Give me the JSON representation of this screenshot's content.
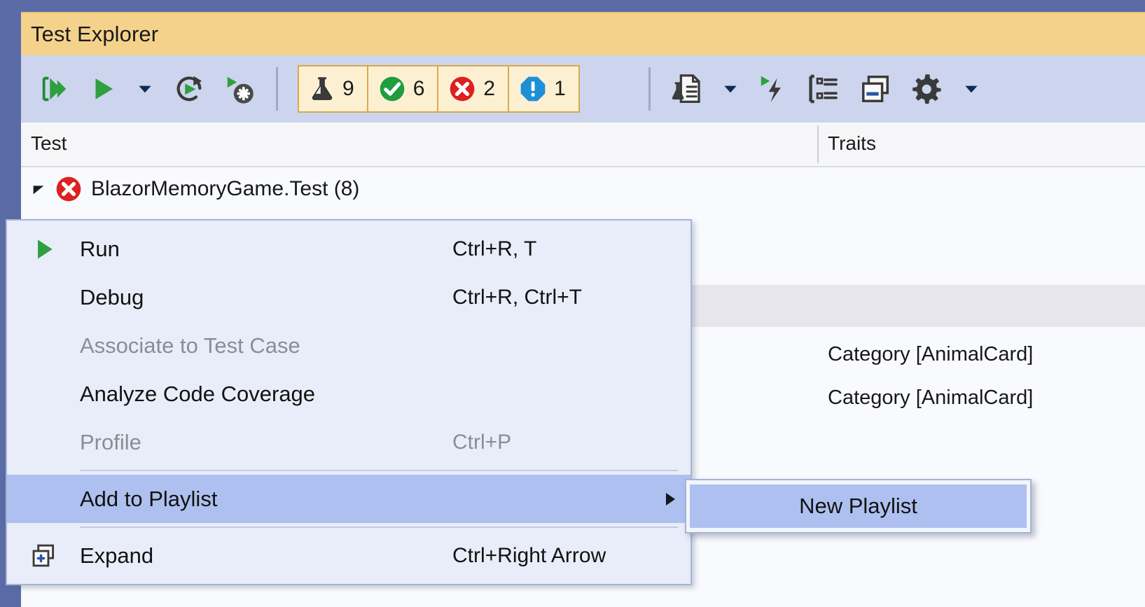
{
  "window": {
    "title": "Test Explorer",
    "chrome_color": "#5a6ba6",
    "titlebar_color": "#f5d28c",
    "toolbar_color": "#ccd5ed"
  },
  "toolbar": {
    "buttons": [
      {
        "name": "run-all-tests",
        "icon": "run-all-icon"
      },
      {
        "name": "run-selected-tests",
        "icon": "play-icon"
      },
      {
        "name": "run-dropdown",
        "icon": "chevron-down-icon"
      },
      {
        "name": "repeat-last-run",
        "icon": "repeat-run-icon"
      },
      {
        "name": "stop-test-run",
        "icon": "stop-run-icon"
      }
    ],
    "counters": [
      {
        "name": "total-tests",
        "icon": "flask-icon",
        "value": "9"
      },
      {
        "name": "passed-tests",
        "icon": "check-circle-icon",
        "value": "6"
      },
      {
        "name": "failed-tests",
        "icon": "error-circle-icon",
        "value": "2"
      },
      {
        "name": "skipped-tests",
        "icon": "info-octagon-icon",
        "value": "1"
      }
    ],
    "right_buttons": [
      {
        "name": "test-detail-summary",
        "icon": "test-document-icon"
      },
      {
        "name": "summary-dropdown",
        "icon": "chevron-down-icon"
      },
      {
        "name": "run-until-failure",
        "icon": "lightning-run-icon"
      },
      {
        "name": "group-by",
        "icon": "group-by-icon"
      },
      {
        "name": "expand-collapse",
        "icon": "window-copy-icon"
      },
      {
        "name": "settings",
        "icon": "gear-icon"
      },
      {
        "name": "settings-dropdown",
        "icon": "chevron-down-icon"
      }
    ]
  },
  "grid": {
    "columns": [
      {
        "key": "test",
        "label": "Test"
      },
      {
        "key": "traits",
        "label": "Traits"
      }
    ],
    "rows": [
      {
        "type": "group",
        "expander": "expanded",
        "status_icon": "error-circle-icon",
        "label": "BlazorMemoryGame.Test  (8)",
        "traits": "",
        "selected": false
      },
      {
        "type": "test",
        "label": "",
        "traits": "",
        "selected": false
      },
      {
        "type": "test",
        "label": "",
        "traits": "",
        "selected": true
      },
      {
        "type": "test",
        "label": "",
        "traits": "Category [AnimalCard]",
        "selected": false
      },
      {
        "type": "test",
        "label": "",
        "traits": "Category [AnimalCard]",
        "selected": false
      }
    ]
  },
  "context_menu": {
    "items": [
      {
        "label": "Run",
        "shortcut": "Ctrl+R, T",
        "icon": "play-icon",
        "disabled": false,
        "highlighted": false,
        "submenu": false,
        "separator_after": false
      },
      {
        "label": "Debug",
        "shortcut": "Ctrl+R, Ctrl+T",
        "icon": "",
        "disabled": false,
        "highlighted": false,
        "submenu": false,
        "separator_after": false
      },
      {
        "label": "Associate to Test Case",
        "shortcut": "",
        "icon": "",
        "disabled": true,
        "highlighted": false,
        "submenu": false,
        "separator_after": false
      },
      {
        "label": "Analyze Code Coverage",
        "shortcut": "",
        "icon": "",
        "disabled": false,
        "highlighted": false,
        "submenu": false,
        "separator_after": false
      },
      {
        "label": "Profile",
        "shortcut": "Ctrl+P",
        "icon": "",
        "disabled": true,
        "highlighted": false,
        "submenu": false,
        "separator_after": true
      },
      {
        "label": "Add to Playlist",
        "shortcut": "",
        "icon": "",
        "disabled": false,
        "highlighted": true,
        "submenu": true,
        "separator_after": true
      },
      {
        "label": "Expand",
        "shortcut": "Ctrl+Right Arrow",
        "icon": "expand-icon",
        "disabled": false,
        "highlighted": false,
        "submenu": false,
        "separator_after": false
      }
    ]
  },
  "submenu": {
    "items": [
      {
        "label": "New Playlist",
        "highlighted": true
      }
    ]
  },
  "colors": {
    "accent_orange": "#f5d28c",
    "accent_blue": "#5a6ba6",
    "menu_bg": "#e8edf9",
    "menu_highlight": "#aec0f0",
    "pass_green": "#1f9d3f",
    "fail_red": "#dd2020",
    "info_blue": "#1e90d8"
  }
}
